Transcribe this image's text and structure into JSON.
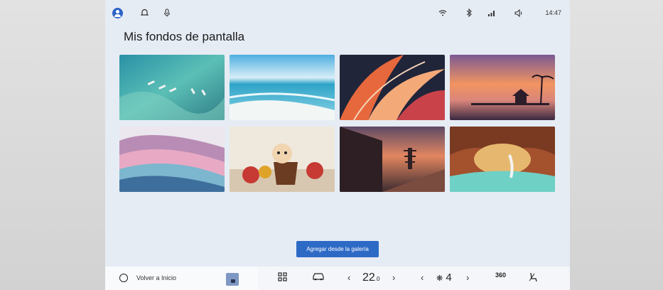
{
  "status": {
    "time": "14:47",
    "left_icons": [
      "user-avatar-icon",
      "bell-icon",
      "mic-icon"
    ],
    "right_icons": [
      "wifi-icon",
      "bluetooth-icon",
      "signal-icon",
      "volume-icon"
    ]
  },
  "page": {
    "title": "Mis fondos de pantalla"
  },
  "wallpapers": [
    {
      "name": "boats-lagoon",
      "colors": [
        "#1f8fa0",
        "#67c3b9",
        "#2a6c7a"
      ]
    },
    {
      "name": "beach-sea",
      "colors": [
        "#74c5e6",
        "#e9f6fb",
        "#9fdcec"
      ]
    },
    {
      "name": "abstract-petals",
      "colors": [
        "#1c2133",
        "#e86c3f",
        "#f4b08b"
      ]
    },
    {
      "name": "sunset-pier",
      "colors": [
        "#8b5c8f",
        "#f08c5a",
        "#3b2a3e"
      ]
    },
    {
      "name": "silk-waves",
      "colors": [
        "#6f4b7f",
        "#e6a8c4",
        "#8bc6d8"
      ]
    },
    {
      "name": "kitten-yarn",
      "colors": [
        "#f0e8dc",
        "#d6b996",
        "#c43b35"
      ]
    },
    {
      "name": "pagoda-terrace",
      "colors": [
        "#7b5b63",
        "#e08661",
        "#3b2c31"
      ]
    },
    {
      "name": "sea-cave",
      "colors": [
        "#b3522c",
        "#e7b56b",
        "#6fd2c9"
      ]
    }
  ],
  "actions": {
    "add_from_gallery": "Agregar desde la galería"
  },
  "bottom_bar": {
    "home_label": "Volver a Inicio",
    "temperature": "22",
    "temperature_decimal": ".0",
    "fan_level": "4",
    "view_360": "360"
  }
}
